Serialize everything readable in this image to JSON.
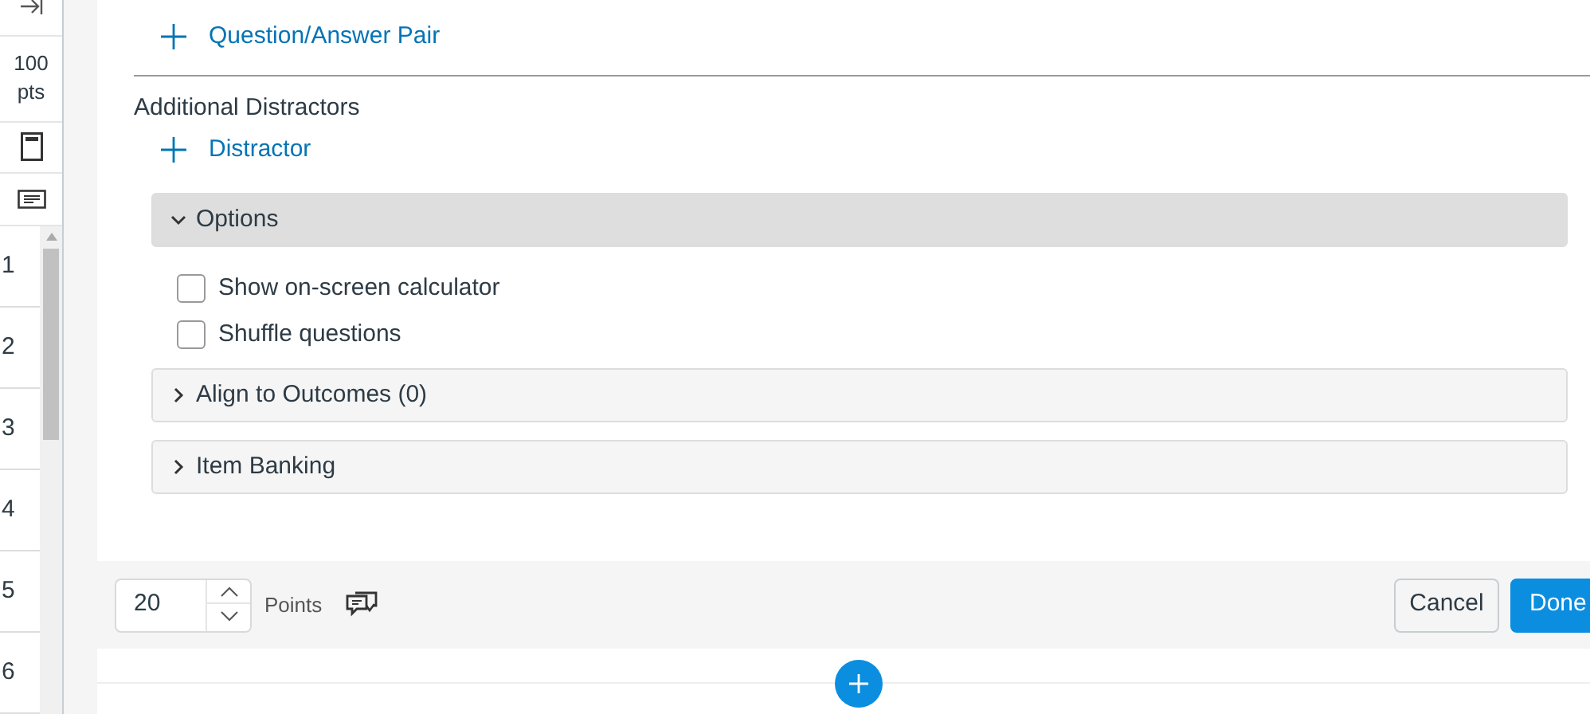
{
  "sidebar": {
    "points": "100 pts",
    "questions": [
      {
        "number": "1"
      },
      {
        "number": "2"
      },
      {
        "number": "3"
      },
      {
        "number": "4"
      },
      {
        "number": "5"
      },
      {
        "number": "6"
      }
    ]
  },
  "editor": {
    "add_pair": {
      "label": "Question/Answer Pair"
    },
    "distractors_heading": "Additional Distractors",
    "add_distractor": {
      "label": "Distractor"
    },
    "sections": [
      {
        "title": "Options",
        "expanded": true,
        "options": [
          {
            "label": "Show on-screen calculator",
            "checked": false
          },
          {
            "label": "Shuffle questions",
            "checked": false
          }
        ]
      },
      {
        "title": "Align to Outcomes (0)",
        "expanded": false
      },
      {
        "title": "Item Banking",
        "expanded": false
      }
    ]
  },
  "footer": {
    "points_value": "20",
    "points_label": "Points",
    "buttons": [
      {
        "label": "Cancel",
        "kind": "secondary"
      },
      {
        "label": "Done",
        "kind": "primary"
      }
    ]
  }
}
